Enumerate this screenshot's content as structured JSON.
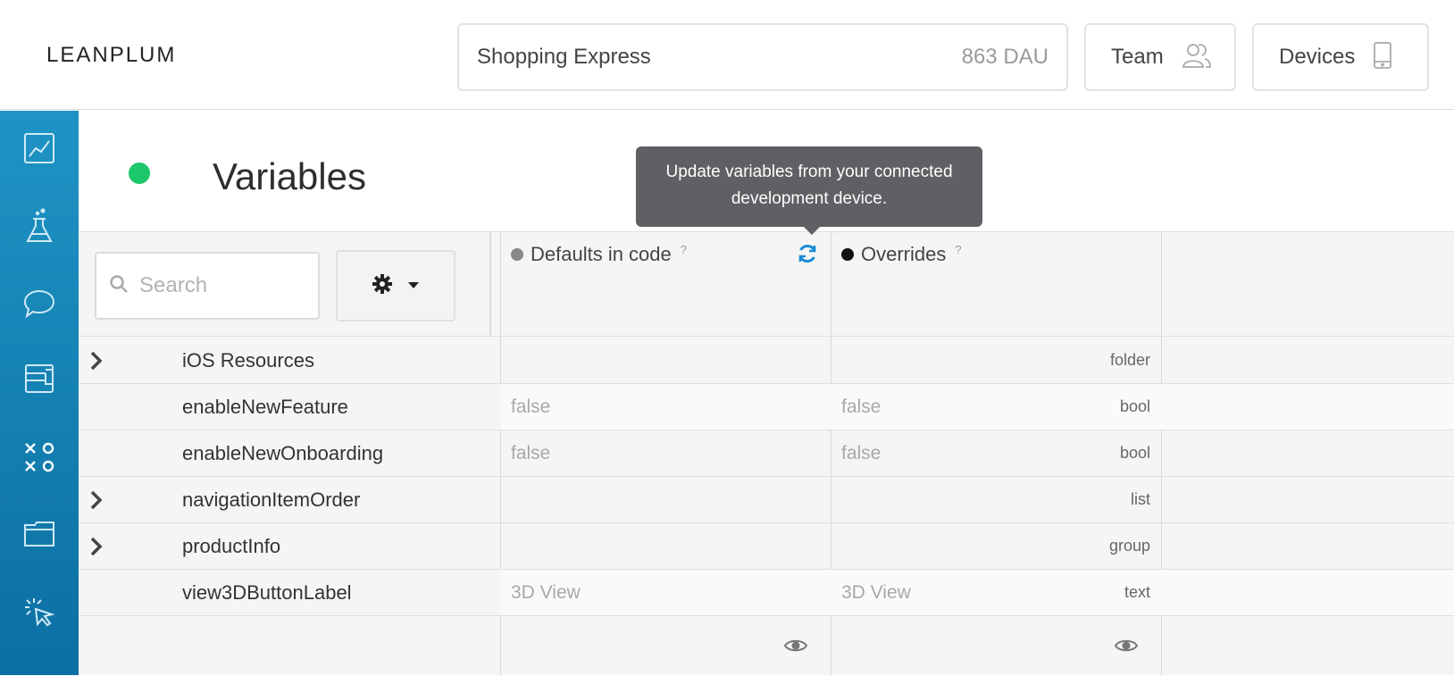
{
  "header": {
    "logo": "LEANPLUM",
    "app_name": "Shopping Express",
    "dau": "863 DAU",
    "team_label": "Team",
    "devices_label": "Devices"
  },
  "sidebar": {
    "items": [
      {
        "icon": "analytics-icon"
      },
      {
        "icon": "ab-test-flask-icon"
      },
      {
        "icon": "messaging-bubble-icon"
      },
      {
        "icon": "campaign-icon"
      },
      {
        "icon": "variables-icon"
      },
      {
        "icon": "files-folder-icon"
      },
      {
        "icon": "interface-editor-icon"
      }
    ]
  },
  "page": {
    "title": "Variables",
    "status_color": "#1dc76b",
    "tooltip": "Update variables from your connected development device."
  },
  "toolbar": {
    "search_placeholder": "Search"
  },
  "columns": {
    "defaults": {
      "label": "Defaults in code",
      "help": "?",
      "dot_color": "#888888"
    },
    "overrides": {
      "label": "Overrides",
      "help": "?",
      "dot_color": "#111111"
    }
  },
  "rows": [
    {
      "expandable": true,
      "type": "folder",
      "name": "iOS Resources",
      "default": "",
      "override": ""
    },
    {
      "expandable": false,
      "type": "bool",
      "name": "enableNewFeature",
      "default": "false",
      "override": "false"
    },
    {
      "expandable": false,
      "type": "bool",
      "name": "enableNewOnboarding",
      "default": "false",
      "override": "false"
    },
    {
      "expandable": true,
      "type": "list",
      "name": "navigationItemOrder",
      "default": "",
      "override": ""
    },
    {
      "expandable": true,
      "type": "group",
      "name": "productInfo",
      "default": "",
      "override": ""
    },
    {
      "expandable": false,
      "type": "text",
      "name": "view3DButtonLabel",
      "default": "3D View",
      "override": "3D View"
    }
  ],
  "colors": {
    "sidebar_top": "#1e94c4",
    "sidebar_bottom": "#0c6fa3",
    "refresh_blue": "#1a8ad6",
    "tooltip_bg": "#5f6063"
  }
}
